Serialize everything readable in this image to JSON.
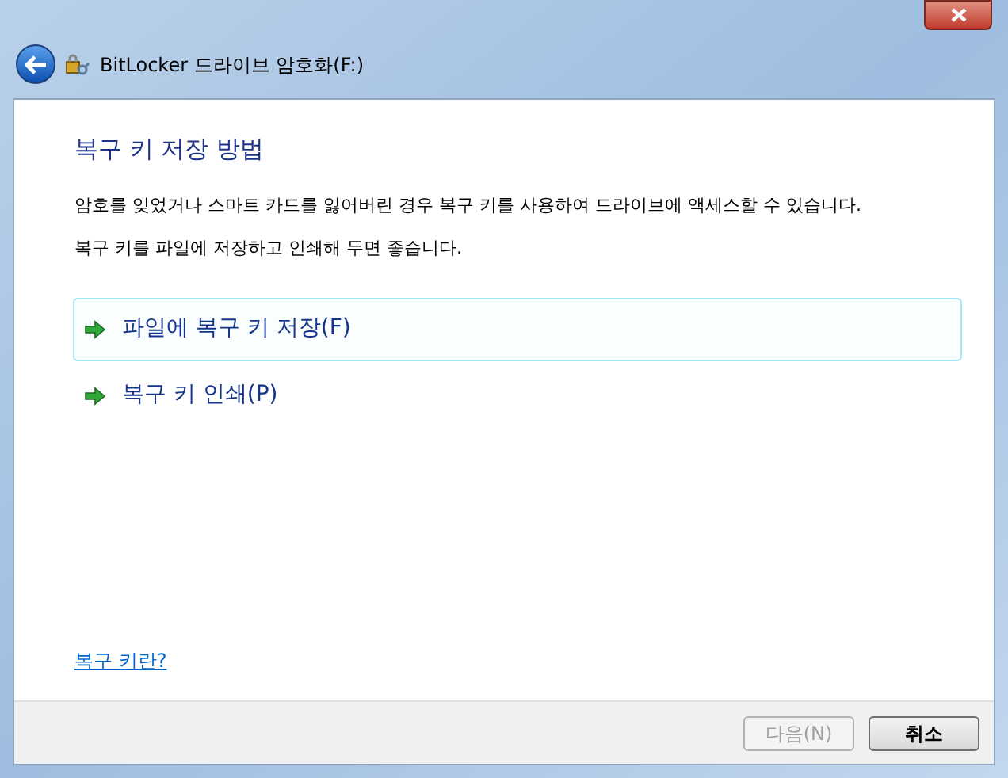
{
  "window": {
    "title": "BitLocker 드라이브 암호화(F:)"
  },
  "heading": "복구 키 저장 방법",
  "paragraphs": [
    "암호를 잊었거나 스마트 카드를 잃어버린 경우 복구 키를 사용하여 드라이브에 액세스할 수 있습니다.",
    "복구 키를 파일에 저장하고 인쇄해 두면 좋습니다."
  ],
  "options": [
    {
      "label": "파일에 복구 키 저장(F)",
      "highlighted": true
    },
    {
      "label": "복구 키 인쇄(P)",
      "highlighted": false
    }
  ],
  "help_link": "복구 키란?",
  "buttons": [
    {
      "label": "다음(N)",
      "disabled": true
    },
    {
      "label": "취소",
      "disabled": false
    }
  ]
}
